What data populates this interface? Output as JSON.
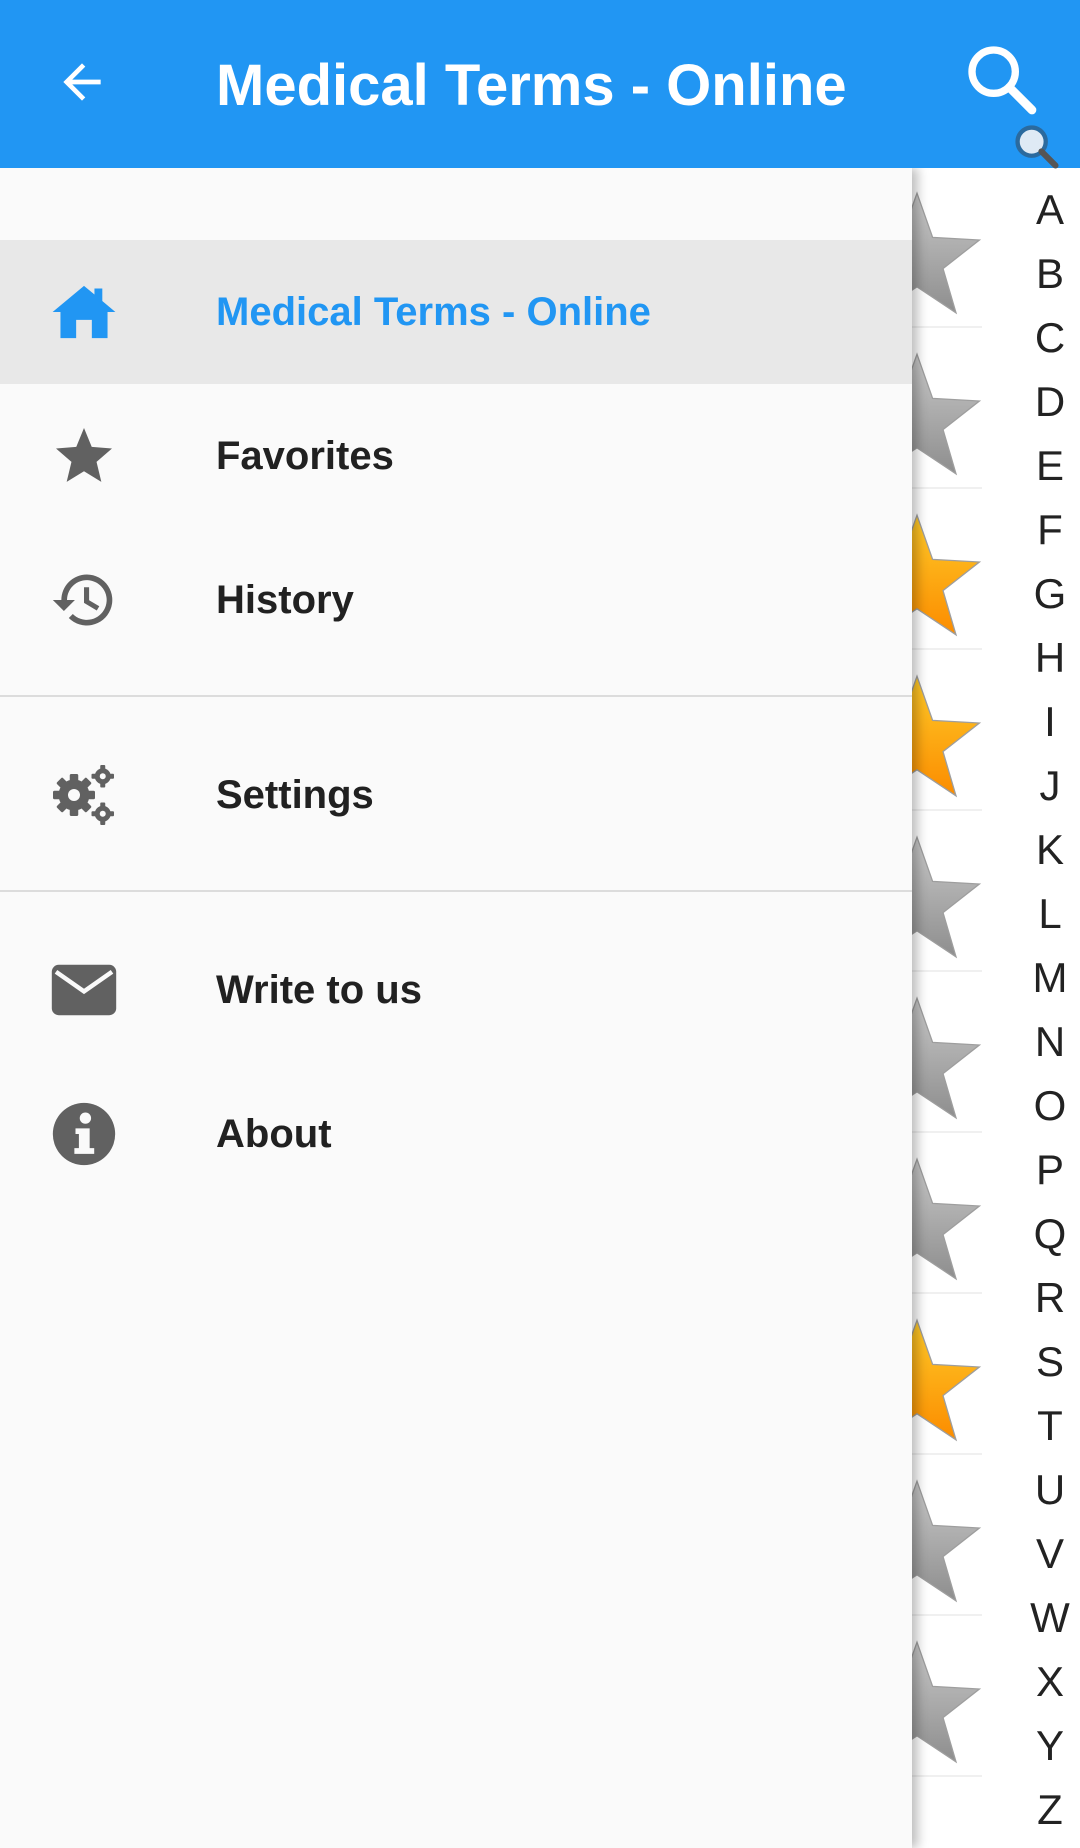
{
  "appbar": {
    "title": "Medical Terms - Online",
    "back_icon": "arrow-left-icon",
    "search_icon": "search-icon",
    "color": "#2196F3"
  },
  "drawer": {
    "items": [
      {
        "label": "Medical Terms - Online",
        "icon": "home-icon",
        "selected": true
      },
      {
        "label": "Favorites",
        "icon": "star-icon"
      },
      {
        "label": "History",
        "icon": "history-icon"
      },
      {
        "label": "Settings",
        "icon": "gears-icon"
      },
      {
        "label": "Write to us",
        "icon": "envelope-icon"
      },
      {
        "label": "About",
        "icon": "info-icon"
      }
    ],
    "accent_color": "#2196F3"
  },
  "background_list": {
    "stars": [
      "gray",
      "gray",
      "gold",
      "gold",
      "gray",
      "gray",
      "gray",
      "gold",
      "gray",
      "gray"
    ]
  },
  "alphabet_index": [
    "A",
    "B",
    "C",
    "D",
    "E",
    "F",
    "G",
    "H",
    "I",
    "J",
    "K",
    "L",
    "M",
    "N",
    "O",
    "P",
    "Q",
    "R",
    "S",
    "T",
    "U",
    "V",
    "W",
    "X",
    "Y",
    "Z"
  ]
}
